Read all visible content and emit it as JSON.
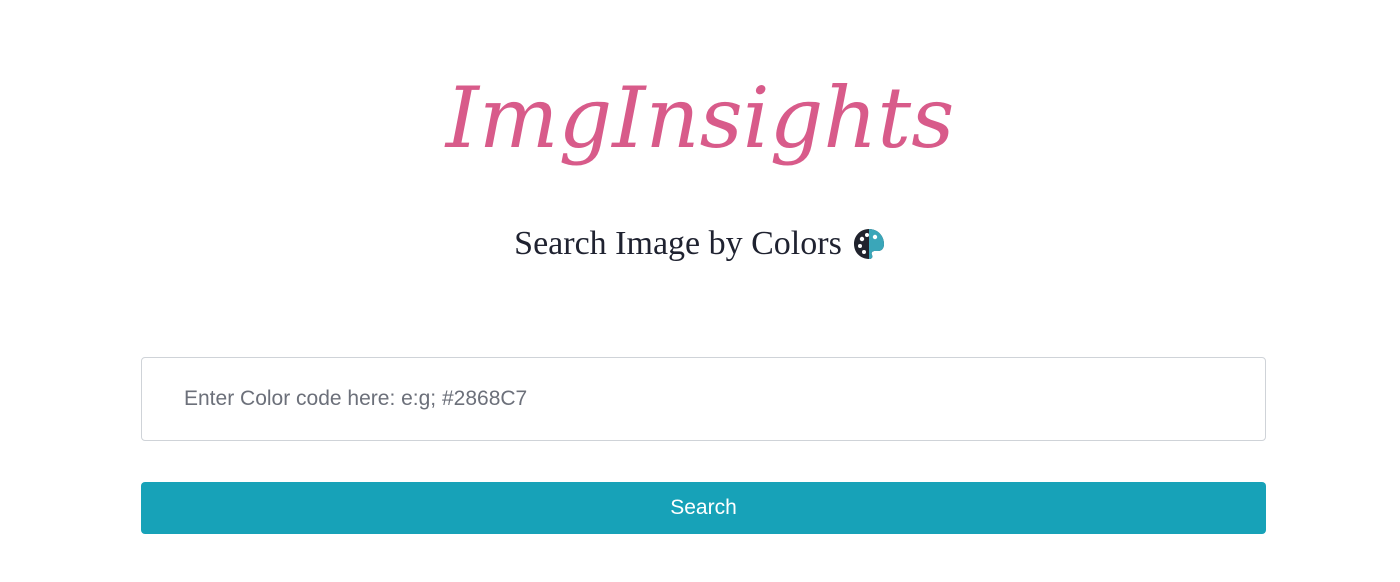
{
  "header": {
    "brand_title": "ImgInsights",
    "subtitle": "Search Image by Colors",
    "subtitle_icon": "artist-palette-icon"
  },
  "search": {
    "placeholder": "Enter Color code here: e:g; #2868C7",
    "value": "",
    "button_label": "Search"
  },
  "colors": {
    "brand": "#d85b8a",
    "accent": "#17a2b8",
    "text": "#1f2230",
    "input_border": "#cfd3d8"
  }
}
